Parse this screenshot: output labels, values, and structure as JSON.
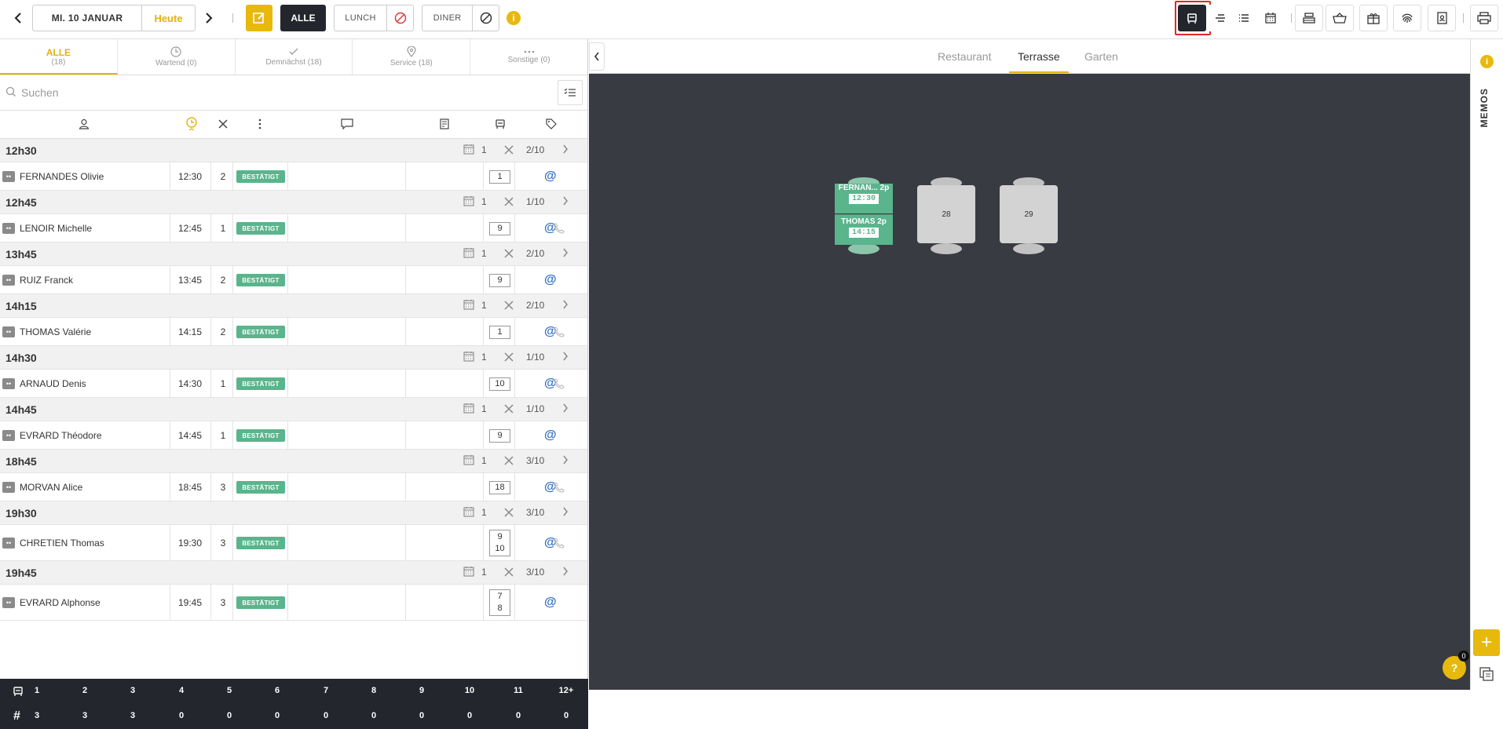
{
  "topbar": {
    "date_label": "MI. 10 JANUAR",
    "today_label": "Heute",
    "alle_label": "ALLE",
    "lunch_label": "LUNCH",
    "diner_label": "DINER",
    "info_label": "i"
  },
  "filter_tabs": [
    {
      "label": "ALLE",
      "count": "(18)"
    },
    {
      "label": "Wartend (0)"
    },
    {
      "label": "Demnächst (18)"
    },
    {
      "label": "Service (18)"
    },
    {
      "label": "Sonstige (0)"
    }
  ],
  "search": {
    "placeholder": "Suchen"
  },
  "groups": [
    {
      "time": "12h30",
      "count": "1",
      "ratio": "2/10"
    },
    {
      "time": "12h45",
      "count": "1",
      "ratio": "1/10"
    },
    {
      "time": "13h45",
      "count": "1",
      "ratio": "2/10"
    },
    {
      "time": "14h15",
      "count": "1",
      "ratio": "2/10"
    },
    {
      "time": "14h30",
      "count": "1",
      "ratio": "1/10"
    },
    {
      "time": "14h45",
      "count": "1",
      "ratio": "1/10"
    },
    {
      "time": "18h45",
      "count": "1",
      "ratio": "3/10"
    },
    {
      "time": "19h30",
      "count": "1",
      "ratio": "3/10"
    },
    {
      "time": "19h45",
      "count": "1",
      "ratio": "3/10"
    }
  ],
  "reservations": [
    {
      "name": "FERNANDES Olivie",
      "time": "12:30",
      "pax": "2",
      "status": "BESTÄTIGT",
      "table": "1",
      "phone": false
    },
    {
      "name": "LENOIR Michelle",
      "time": "12:45",
      "pax": "1",
      "status": "BESTÄTIGT",
      "table": "9",
      "phone": true
    },
    {
      "name": "RUIZ Franck",
      "time": "13:45",
      "pax": "2",
      "status": "BESTÄTIGT",
      "table": "9",
      "phone": false
    },
    {
      "name": "THOMAS Valérie",
      "time": "14:15",
      "pax": "2",
      "status": "BESTÄTIGT",
      "table": "1",
      "phone": true
    },
    {
      "name": "ARNAUD Denis",
      "time": "14:30",
      "pax": "1",
      "status": "BESTÄTIGT",
      "table": "10",
      "phone": true
    },
    {
      "name": "EVRARD Théodore",
      "time": "14:45",
      "pax": "1",
      "status": "BESTÄTIGT",
      "table": "9",
      "phone": false
    },
    {
      "name": "MORVAN Alice",
      "time": "18:45",
      "pax": "3",
      "status": "BESTÄTIGT",
      "table": "18",
      "phone": true
    },
    {
      "name": "CHRETIEN Thomas",
      "time": "19:30",
      "pax": "3",
      "status": "BESTÄTIGT",
      "table": "9",
      "table2": "10",
      "phone": true
    },
    {
      "name": "EVRARD Alphonse",
      "time": "19:45",
      "pax": "3",
      "status": "BESTÄTIGT",
      "table": "7",
      "table2": "8",
      "phone": false
    }
  ],
  "bottom": {
    "sizes": [
      "1",
      "2",
      "3",
      "4",
      "5",
      "6",
      "7",
      "8",
      "9",
      "10",
      "11",
      "12+"
    ],
    "counts": [
      "3",
      "3",
      "3",
      "0",
      "0",
      "0",
      "0",
      "0",
      "0",
      "0",
      "0",
      "0"
    ]
  },
  "floor_tabs": [
    "Restaurant",
    "Terrasse",
    "Garten"
  ],
  "active_floor": "Terrasse",
  "tables": [
    {
      "number": "",
      "res1_name": "FERNAN... 2p",
      "res1_time": "12:30",
      "res2_name": "THOMAS  2p",
      "res2_time": "14:15"
    },
    {
      "number": "28"
    },
    {
      "number": "29"
    }
  ],
  "sidebar": {
    "memos_label": "MEMOS",
    "plus_label": "+",
    "help_label": "?",
    "help_badge": "0"
  },
  "colors": {
    "accent": "#e8b90d",
    "dark": "#23262c",
    "confirmed": "#5ab48c",
    "floor": "#383b41",
    "link": "#2f6fc2"
  }
}
